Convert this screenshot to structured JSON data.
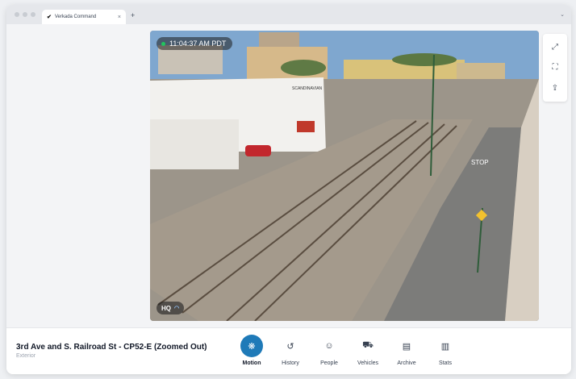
{
  "browser": {
    "tab_title": "Verkada Command",
    "tab_close": "×",
    "new_tab": "+",
    "chevron": "⌄"
  },
  "video": {
    "timestamp": "11:04:37 AM PDT",
    "quality": "HQ",
    "sign_label": "SCANDINAVIAN",
    "street_text": "STOP"
  },
  "tools": [
    {
      "name": "fullscreen-icon",
      "glyph": "⤢"
    },
    {
      "name": "zoom-fit-icon",
      "glyph": "⛶"
    },
    {
      "name": "share-icon",
      "glyph": "⇪"
    }
  ],
  "camera": {
    "title": "3rd Ave and S. Railroad St - CP52-E (Zoomed Out)",
    "subtitle": "Exterior"
  },
  "actions": [
    {
      "label": "Motion",
      "icon": "motion-icon",
      "glyph": "❋",
      "active": true
    },
    {
      "label": "History",
      "icon": "history-icon",
      "glyph": "↺",
      "active": false
    },
    {
      "label": "People",
      "icon": "people-icon",
      "glyph": "☺",
      "active": false
    },
    {
      "label": "Vehicles",
      "icon": "vehicle-icon",
      "glyph": "⛟",
      "active": false
    },
    {
      "label": "Archive",
      "icon": "archive-icon",
      "glyph": "▤",
      "active": false
    },
    {
      "label": "Stats",
      "icon": "stats-icon",
      "glyph": "▥",
      "active": false
    }
  ],
  "colors": {
    "accent": "#1f7ab8",
    "live": "#22c55e"
  }
}
